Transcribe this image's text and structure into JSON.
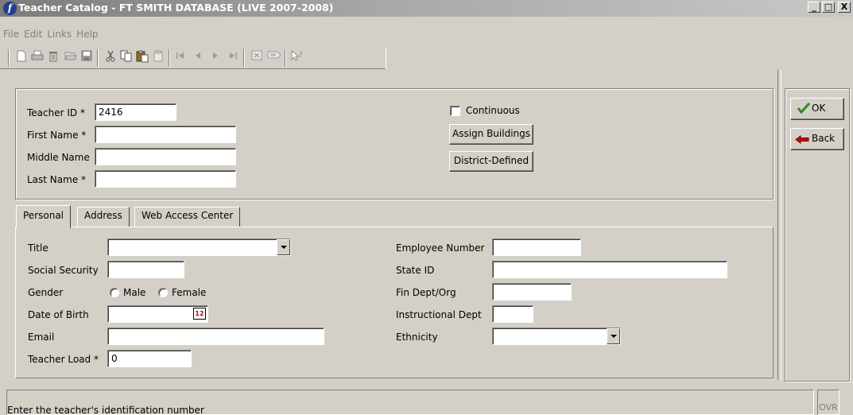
{
  "window": {
    "title": "Teacher Catalog - FT SMITH DATABASE (LIVE 2007-2008)",
    "minimize_label": "_",
    "restore_label": "□",
    "close_label": "X"
  },
  "menu": [
    "File",
    "Edit",
    "Links",
    "Help"
  ],
  "toolbar": {
    "icons": [
      "new-icon",
      "print-icon",
      "delete-icon",
      "open-icon",
      "save-icon",
      "cut-icon",
      "copy-icon",
      "paste-icon",
      "paste-special-icon",
      "first-record-icon",
      "previous-record-icon",
      "next-record-icon",
      "last-record-icon",
      "close-record-icon",
      "filter-icon",
      "help-pointer-icon"
    ]
  },
  "header": {
    "teacher_id_label": "Teacher ID *",
    "teacher_id_value": "2416",
    "first_name_label": "First Name *",
    "first_name_value": "",
    "middle_name_label": "Middle Name",
    "middle_name_value": "",
    "last_name_label": "Last Name *",
    "last_name_value": "",
    "continuous_label": "Continuous",
    "continuous_checked": false,
    "assign_buildings_label": "Assign Buildings",
    "district_defined_label": "District-Defined"
  },
  "tabs": [
    {
      "label": "Personal",
      "active": true
    },
    {
      "label": "Address",
      "active": false
    },
    {
      "label": "Web Access Center",
      "active": false
    }
  ],
  "personal": {
    "title_label": "Title",
    "title_value": "",
    "ssn_label": "Social Security",
    "ssn_value": "",
    "gender_label": "Gender",
    "gender_options": [
      "Male",
      "Female"
    ],
    "gender_selected": null,
    "dob_label": "Date of Birth",
    "dob_value": "",
    "email_label": "Email",
    "email_value": "",
    "teacher_load_label": "Teacher Load *",
    "teacher_load_value": "0",
    "employee_number_label": "Employee Number",
    "employee_number_value": "",
    "state_id_label": "State ID",
    "state_id_value": "",
    "fin_dept_label": "Fin Dept/Org",
    "fin_dept_value": "",
    "instructional_dept_label": "Instructional Dept",
    "instructional_dept_value": "",
    "ethnicity_label": "Ethnicity",
    "ethnicity_value": ""
  },
  "side_buttons": {
    "ok_label": "OK",
    "back_label": "Back"
  },
  "status": {
    "message": "Enter the teacher's identification number",
    "mode": "OVR"
  },
  "colors": {
    "window_bg": "#d4d0c8",
    "titlebar_inactive": "#a8a8a8",
    "ok_check": "#2e8b1e",
    "back_arrow": "#c01010",
    "app_icon": "#1f3f8f"
  }
}
